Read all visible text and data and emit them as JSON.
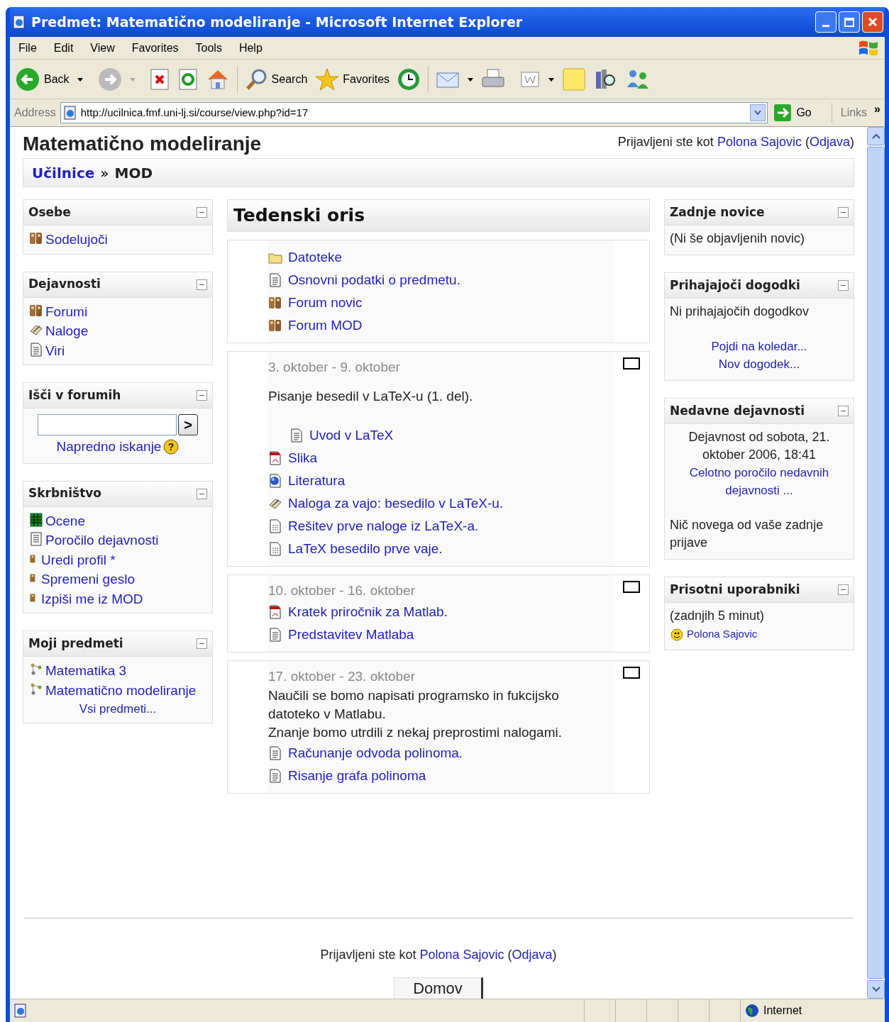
{
  "window": {
    "title": "Predmet: Matematično modeliranje - Microsoft Internet Explorer"
  },
  "menu_bar": [
    "File",
    "Edit",
    "View",
    "Favorites",
    "Tools",
    "Help"
  ],
  "toolbar": {
    "back_label": "Back",
    "search_label": "Search",
    "favorites_label": "Favorites"
  },
  "address_bar": {
    "label": "Address",
    "url": "http://ucilnica.fmf.uni-lj.si/course/view.php?id=17",
    "go_label": "Go",
    "links_label": "Links",
    "more": "»"
  },
  "page": {
    "title": "Matematično modeliranje",
    "login": {
      "prefix": "Prijavljeni ste kot",
      "user": "Polona Sajovic",
      "open": "(",
      "logout": "Odjava",
      "close": ")"
    },
    "breadcrumb": {
      "items": [
        "Učilnice",
        "MOD"
      ],
      "separator": "»"
    },
    "left_blocks": [
      {
        "kind": "links",
        "title": "Osebe",
        "items": [
          {
            "kind": "people",
            "label": "Sodelujoči"
          }
        ]
      },
      {
        "kind": "links",
        "title": "Dejavnosti",
        "items": [
          {
            "kind": "people",
            "label": "Forumi"
          },
          {
            "kind": "assignment",
            "label": "Naloge"
          },
          {
            "kind": "document",
            "label": "Viri"
          }
        ]
      },
      {
        "kind": "search",
        "title": "Išči v forumih",
        "submit": ">",
        "link": "Napredno iskanje",
        "help": "?"
      },
      {
        "kind": "links",
        "title": "Skrbništvo",
        "items": [
          {
            "kind": "grades",
            "label": "Ocene"
          },
          {
            "kind": "report",
            "label": "Poročilo dejavnosti"
          },
          {
            "kind": "user",
            "label": "Uredi profil *"
          },
          {
            "kind": "user",
            "label": "Spremeni geslo"
          },
          {
            "kind": "user",
            "label": "Izpiši me iz MOD"
          }
        ]
      },
      {
        "kind": "links",
        "title": "Moji predmeti",
        "items": [
          {
            "kind": "course",
            "label": "Matematika 3"
          },
          {
            "kind": "course",
            "label": "Matematično modeliranje"
          }
        ],
        "more": "Vsi predmeti..."
      }
    ],
    "center": {
      "title": "Tedenski oris",
      "sections": [
        {
          "items": [
            {
              "kind": "folder",
              "label": "Datoteke",
              "indented": false
            },
            {
              "kind": "document",
              "label": "Osnovni podatki o predmetu.",
              "indented": false
            },
            {
              "kind": "people",
              "label": "Forum novic",
              "indented": false
            },
            {
              "kind": "people",
              "label": "Forum MOD",
              "indented": false
            }
          ]
        },
        {
          "dates": "3. oktober - 9. oktober",
          "summary": [
            "Pisanje besedil v LaTeX-u (1. del)."
          ],
          "items": [
            {
              "kind": "document",
              "label": "Uvod v LaTeX",
              "indented": true
            },
            {
              "kind": "pdf",
              "label": "Slika",
              "indented": false
            },
            {
              "kind": "web",
              "label": "Literatura",
              "indented": false
            },
            {
              "kind": "assignment",
              "label": "Naloga za vajo: besedilo v LaTeX-u.",
              "indented": false
            },
            {
              "kind": "text",
              "label": "Rešitev prve naloge iz LaTeX-a.",
              "indented": false
            },
            {
              "kind": "text",
              "label": "LaTeX besedilo prve vaje.",
              "indented": false
            }
          ]
        },
        {
          "dates": "10. oktober - 16. oktober",
          "items": [
            {
              "kind": "pdf",
              "label": "Kratek priročnik za Matlab.",
              "indented": false
            },
            {
              "kind": "document",
              "label": "Predstavitev Matlaba",
              "indented": false
            }
          ]
        },
        {
          "dates": "17. oktober - 23. oktober",
          "summary": [
            "Naučili se bomo napisati programsko in fukcijsko datoteko v Matlabu.",
            "Znanje bomo utrdili z nekaj preprostimi nalogami."
          ],
          "items": [
            {
              "kind": "document",
              "label": "Računanje odvoda polinoma.",
              "indented": false
            },
            {
              "kind": "document",
              "label": "Risanje grafa polinoma",
              "indented": false
            }
          ]
        }
      ]
    },
    "right_blocks": [
      {
        "title": "Zadnje novice",
        "content": [
          {
            "kind": "text",
            "text": "(Ni še objavljenih novic)"
          }
        ]
      },
      {
        "title": "Prihajajoči dogodki",
        "content": [
          {
            "kind": "text",
            "text": "Ni prihajajočih dogodkov"
          },
          {
            "kind": "center_link",
            "text": "Pojdi na koledar..."
          },
          {
            "kind": "center_link",
            "text": "Nov dogodek..."
          }
        ]
      },
      {
        "title": "Nedavne dejavnosti",
        "content": [
          {
            "kind": "center_text",
            "text": "Dejavnost od sobota, 21. oktober 2006, 18:41"
          },
          {
            "kind": "center_link",
            "text": "Celotno poročilo nedavnih dejavnosti ..."
          },
          {
            "kind": "text",
            "text": "Nič novega od vaše zadnje prijave"
          }
        ]
      },
      {
        "title": "Prisotni uporabniki",
        "content": [
          {
            "kind": "text",
            "text": "(zadnjih 5 minut)"
          },
          {
            "kind": "user_link",
            "text": "Polona Sajovic"
          }
        ]
      }
    ],
    "footer": {
      "login": {
        "prefix": "Prijavljeni ste kot",
        "user": "Polona Sajovic",
        "open": "(",
        "logout": "Odjava",
        "close": ")"
      },
      "home_button": "Domov"
    }
  },
  "status_bar": {
    "zone": "Internet"
  }
}
